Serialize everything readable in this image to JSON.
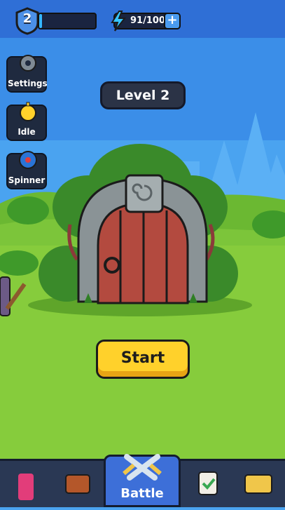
{
  "hud": {
    "player_level": "2",
    "xp_progress": 0.05,
    "energy_text": "91/100",
    "energy_plus": "+"
  },
  "side_menu": [
    {
      "label": "Settings",
      "icon": "gear-icon"
    },
    {
      "label": "Idle",
      "icon": "stopwatch-icon"
    },
    {
      "label": "Spinner",
      "icon": "spinner-wheel-icon"
    }
  ],
  "stage": {
    "level_label": "Level 2"
  },
  "start_button": "Start",
  "nav": {
    "active_label": "Battle",
    "items": [
      "shop-icon",
      "chest-icon",
      "battle-swords-icon",
      "quests-clipboard-icon",
      "treasure-chest-icon"
    ]
  },
  "colors": {
    "sky": "#4aa3f0",
    "grass": "#86cc3c",
    "start_button": "#ffd12b",
    "nav_active": "#3d6fd8"
  }
}
